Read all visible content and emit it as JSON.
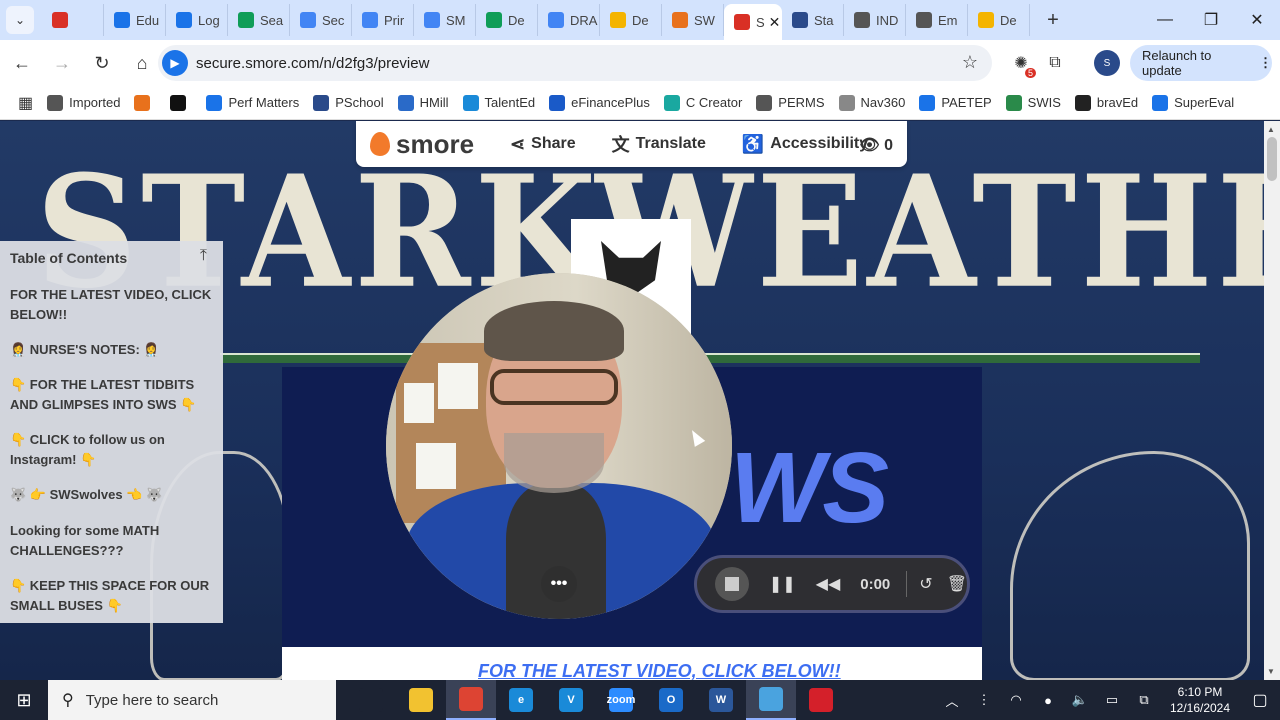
{
  "browser": {
    "tabs": [
      {
        "label": "",
        "favicon_color": "#d93025",
        "icon": "record-icon"
      },
      {
        "label": "Edu",
        "favicon_color": "#1a73e8",
        "icon": "puzzle-icon"
      },
      {
        "label": "Log",
        "favicon_color": "#1a73e8",
        "icon": "flag-icon"
      },
      {
        "label": "Sea",
        "favicon_color": "#0f9d58",
        "icon": "drive-icon"
      },
      {
        "label": "Sec",
        "favicon_color": "#4285f4",
        "icon": "doc-icon"
      },
      {
        "label": "Prir",
        "favicon_color": "#4285f4",
        "icon": "doc-icon"
      },
      {
        "label": "SM",
        "favicon_color": "#4285f4",
        "icon": "doc-icon"
      },
      {
        "label": "De",
        "favicon_color": "#0f9d58",
        "icon": "sheet-icon"
      },
      {
        "label": "DRA",
        "favicon_color": "#4285f4",
        "icon": "doc-icon"
      },
      {
        "label": "De",
        "favicon_color": "#f4b400",
        "icon": "slides-icon"
      },
      {
        "label": "SW",
        "favicon_color": "#e8711c",
        "icon": "smore-icon"
      },
      {
        "label": "S",
        "favicon_color": "#d93025",
        "icon": "record-icon",
        "active": true
      },
      {
        "label": "Sta",
        "favicon_color": "#2a4a8a",
        "icon": "sis-icon"
      },
      {
        "label": "IND",
        "favicon_color": "#555555",
        "icon": "globe-icon"
      },
      {
        "label": "Em",
        "favicon_color": "#555555",
        "icon": "globe-icon"
      },
      {
        "label": "De",
        "favicon_color": "#f4b400",
        "icon": "slides-icon"
      }
    ],
    "url": "secure.smore.com/n/d2fg3/preview",
    "relaunch_label": "Relaunch to update",
    "extension_badge": "5",
    "bookmarks": [
      {
        "label": "Imported",
        "icon": "folder-icon",
        "color": "#555555"
      },
      {
        "label": "",
        "icon": "chrome-color-icon",
        "color": "#e8711c"
      },
      {
        "label": "",
        "icon": "one-icon",
        "color": "#111111"
      },
      {
        "label": "Perf Matters",
        "icon": "p-icon",
        "color": "#1a73e8"
      },
      {
        "label": "PSchool",
        "icon": "sis-icon",
        "color": "#2a4a8a"
      },
      {
        "label": "HMill",
        "icon": "hmill-icon",
        "color": "#2a6ac8"
      },
      {
        "label": "TalentEd",
        "icon": "talented-icon",
        "color": "#1a8ad8"
      },
      {
        "label": "eFinancePlus",
        "icon": "efinance-icon",
        "color": "#1a5ac8"
      },
      {
        "label": "C Creator",
        "icon": "creator-icon",
        "color": "#1aa8a0"
      },
      {
        "label": "PERMS",
        "icon": "globe-icon",
        "color": "#555555"
      },
      {
        "label": "Nav360",
        "icon": "nav-icon",
        "color": "#888888"
      },
      {
        "label": "PAETEP",
        "icon": "puzzle-icon",
        "color": "#1a73e8"
      },
      {
        "label": "SWIS",
        "icon": "swis-icon",
        "color": "#2a8a4a"
      },
      {
        "label": "bravEd",
        "icon": "braved-icon",
        "color": "#222222"
      },
      {
        "label": "SuperEval",
        "icon": "supereval-icon",
        "color": "#1a73e8"
      }
    ]
  },
  "smore": {
    "logo": "smore",
    "share": "Share",
    "translate": "Translate",
    "accessibility": "Accessibility",
    "views": "0"
  },
  "banner": {
    "title": "STARKWEATHER",
    "sws": "WS"
  },
  "toc": {
    "heading": "Table of Contents",
    "items": [
      "FOR THE LATEST VIDEO, CLICK BELOW!!",
      "👩‍⚕️ NURSE'S NOTES: 👩‍⚕️",
      "👇 FOR THE LATEST TIDBITS AND GLIMPSES INTO SWS 👇",
      "👇 CLICK to follow us on Instagram! 👇",
      "🐺 👉 SWSwolves 👈 🐺",
      "Looking for some MATH CHALLENGES???",
      "👇 KEEP THIS SPACE FOR OUR SMALL BUSES 👇"
    ]
  },
  "content": {
    "section_link": "FOR THE LATEST VIDEO, CLICK BELOW!!"
  },
  "recorder": {
    "time": "0:00"
  },
  "taskbar": {
    "search_placeholder": "Type here to search",
    "apps": [
      {
        "name": "task-view-icon",
        "label": "",
        "color": "#1c2333"
      },
      {
        "name": "file-explorer-icon",
        "label": "",
        "color": "#f2c230"
      },
      {
        "name": "chrome-icon",
        "label": "",
        "color": "#dd4433",
        "active": true
      },
      {
        "name": "edge-icon",
        "label": "e",
        "color": "#1a8ad8"
      },
      {
        "name": "vectra-icon",
        "label": "V",
        "color": "#1a8ad8"
      },
      {
        "name": "zoom-icon",
        "label": "zoom",
        "color": "#2d8cff"
      },
      {
        "name": "outlook-icon",
        "label": "O",
        "color": "#1a6ac8"
      },
      {
        "name": "word-icon",
        "label": "W",
        "color": "#2b579a"
      },
      {
        "name": "recorder-app-icon",
        "label": "",
        "color": "#4aa3df",
        "active": true
      },
      {
        "name": "acrobat-icon",
        "label": "",
        "color": "#d4202a"
      }
    ],
    "time": "6:10 PM",
    "date": "12/16/2024"
  }
}
